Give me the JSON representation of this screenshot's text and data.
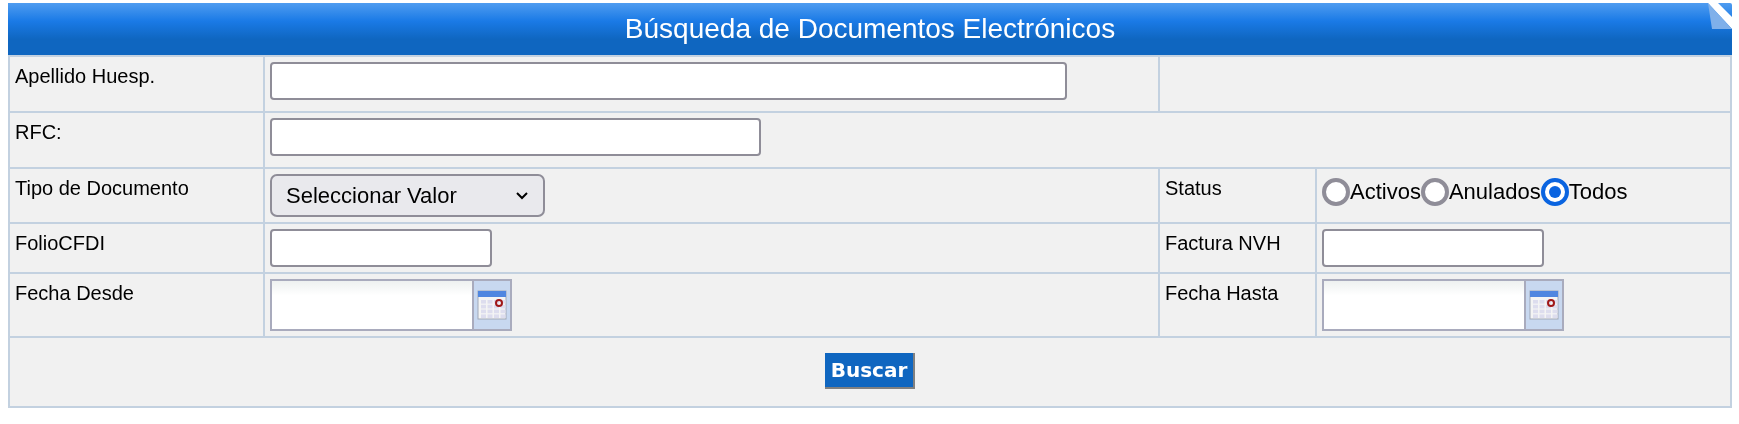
{
  "title": "Búsqueda de Documentos Electrónicos",
  "rows": [
    {
      "kind": "wide_text",
      "label": "Apellido Huesp."
    },
    {
      "kind": "medium_text",
      "label": "RFC:"
    },
    {
      "kind": "pair",
      "left": {
        "kind": "select",
        "label": "Tipo de Documento",
        "value": "Seleccionar Valor"
      },
      "right": {
        "kind": "radios",
        "label": "Status",
        "options": [
          {
            "label": "Activos",
            "selected": false
          },
          {
            "label": "Anulados",
            "selected": false
          },
          {
            "label": "Todos",
            "selected": true
          }
        ]
      }
    },
    {
      "kind": "pair",
      "left": {
        "kind": "text",
        "label": "FolioCFDI"
      },
      "right": {
        "kind": "text",
        "label": "Factura NVH"
      }
    },
    {
      "kind": "pair",
      "left": {
        "kind": "date",
        "label": "Fecha Desde"
      },
      "right": {
        "kind": "date",
        "label": "Fecha Hasta"
      }
    }
  ],
  "button": "Buscar"
}
